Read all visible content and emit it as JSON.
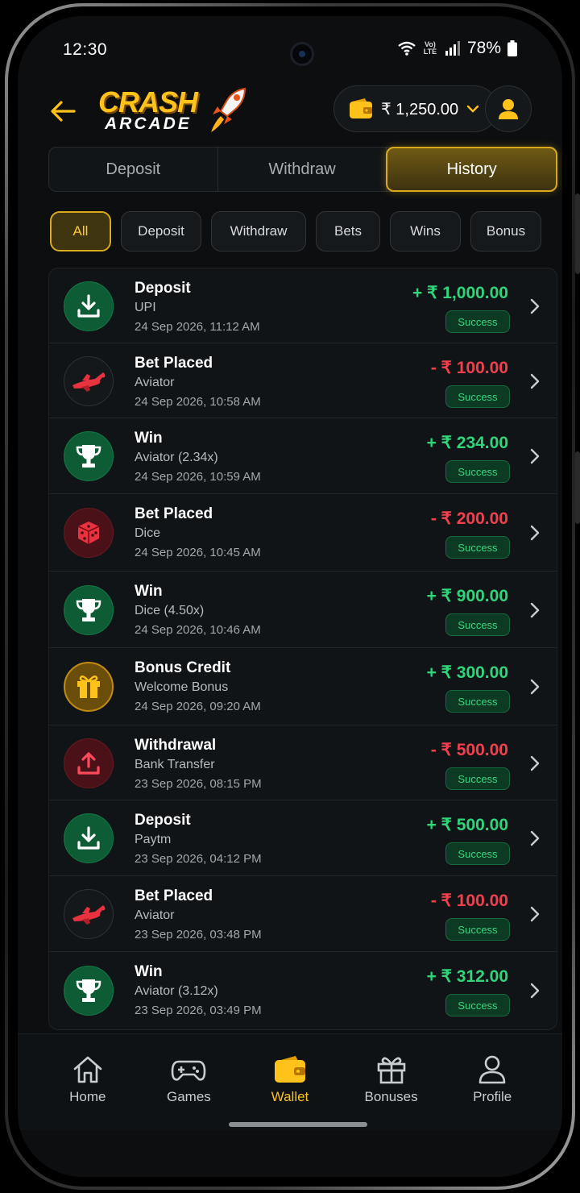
{
  "status_bar": {
    "time": "12:30",
    "network": "Vo) LTE",
    "battery": "78%"
  },
  "header": {
    "logo_line1": "CRASH",
    "logo_line2": "ARCADE",
    "balance": "₹ 1,250.00",
    "accent_color": "#ffc21a"
  },
  "main_tabs": [
    {
      "label": "Deposit",
      "active": false
    },
    {
      "label": "Withdraw",
      "active": false
    },
    {
      "label": "History",
      "active": true
    }
  ],
  "filters": [
    {
      "label": "All",
      "active": true
    },
    {
      "label": "Deposit",
      "active": false
    },
    {
      "label": "Withdraw",
      "active": false
    },
    {
      "label": "Bets",
      "active": false
    },
    {
      "label": "Wins",
      "active": false
    },
    {
      "label": "Bonus",
      "active": false
    }
  ],
  "transactions": [
    {
      "icon": "download-icon",
      "title": "Deposit",
      "subtitle": "UPI",
      "date": "24 Sep 2026, 11:12 AM",
      "amount": "+ ₹ 1,000.00",
      "type": "credit",
      "status": "Success"
    },
    {
      "icon": "airplane-icon",
      "title": "Bet Placed",
      "subtitle": "Aviator",
      "date": "24 Sep 2026, 10:58 AM",
      "amount": "- ₹ 100.00",
      "type": "debit",
      "status": "Success"
    },
    {
      "icon": "trophy-icon",
      "title": "Win",
      "subtitle": "Aviator (2.34x)",
      "date": "24 Sep 2026, 10:59 AM",
      "amount": "+ ₹ 234.00",
      "type": "credit",
      "status": "Success"
    },
    {
      "icon": "dice-icon",
      "title": "Bet Placed",
      "subtitle": "Dice",
      "date": "24 Sep 2026, 10:45 AM",
      "amount": "- ₹ 200.00",
      "type": "debit",
      "status": "Success"
    },
    {
      "icon": "trophy-icon",
      "title": "Win",
      "subtitle": "Dice (4.50x)",
      "date": "24 Sep 2026, 10:46 AM",
      "amount": "+ ₹ 900.00",
      "type": "credit",
      "status": "Success"
    },
    {
      "icon": "gift-icon",
      "title": "Bonus Credit",
      "subtitle": "Welcome Bonus",
      "date": "24 Sep 2026, 09:20 AM",
      "amount": "+ ₹ 300.00",
      "type": "credit",
      "status": "Success"
    },
    {
      "icon": "upload-icon",
      "title": "Withdrawal",
      "subtitle": "Bank Transfer",
      "date": "23 Sep 2026, 08:15 PM",
      "amount": "- ₹ 500.00",
      "type": "debit",
      "status": "Success"
    },
    {
      "icon": "download-icon",
      "title": "Deposit",
      "subtitle": "Paytm",
      "date": "23 Sep 2026, 04:12 PM",
      "amount": "+ ₹ 500.00",
      "type": "credit",
      "status": "Success"
    },
    {
      "icon": "airplane-icon",
      "title": "Bet Placed",
      "subtitle": "Aviator",
      "date": "23 Sep 2026, 03:48 PM",
      "amount": "- ₹ 100.00",
      "type": "debit",
      "status": "Success"
    },
    {
      "icon": "trophy-icon",
      "title": "Win",
      "subtitle": "Aviator (3.12x)",
      "date": "23 Sep 2026, 03:49 PM",
      "amount": "+ ₹ 312.00",
      "type": "credit",
      "status": "Success"
    }
  ],
  "bottom_nav": [
    {
      "label": "Home",
      "icon": "home-icon",
      "active": false
    },
    {
      "label": "Games",
      "icon": "gamepad-icon",
      "active": false
    },
    {
      "label": "Wallet",
      "icon": "wallet-icon",
      "active": true
    },
    {
      "label": "Bonuses",
      "icon": "gift-icon",
      "active": false
    },
    {
      "label": "Profile",
      "icon": "user-icon",
      "active": false
    }
  ]
}
